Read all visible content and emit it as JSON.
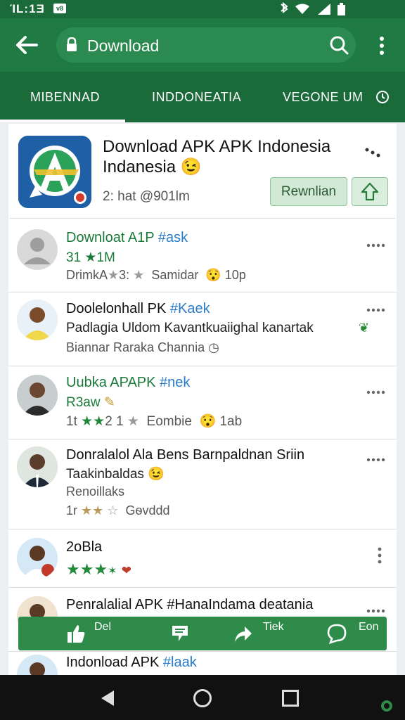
{
  "status_bar": {
    "time": "ΊL:1Ǝ",
    "notification": "v8"
  },
  "toolbar": {
    "search_value": "Download"
  },
  "tabs": [
    {
      "label": "MIBENNAD"
    },
    {
      "label": "INDDONEATIA"
    },
    {
      "label": "VEGONE UM"
    }
  ],
  "app": {
    "title": "Download APK APK Indonesia Indanesia",
    "title_emoji": "😉",
    "meta": "2: hat @901lm",
    "install_label": "Rewnlian"
  },
  "reviews": [
    {
      "title": "Downloat A1P",
      "tag": "#ask",
      "line1": "31 ★1M",
      "meta_prefix": "DrimkA",
      "meta_mid": "3:",
      "meta_name": "Samidar",
      "meta_time": "10p"
    },
    {
      "title": "Doolelonhall PK",
      "tag": "#Kaek",
      "line1": "Padlagia Uldom Kavantkuaiighal  kanartak",
      "line2": "Biannar Raraka Channia"
    },
    {
      "title": "Uubka APAPK",
      "tag": "#nek",
      "line1": "R3aw",
      "meta_prefix": "1t",
      "meta_mid": "2 1",
      "meta_name": "Eombie",
      "meta_time": "1ab"
    },
    {
      "title": "Donralalol Ala Bens Barnpaldnan Sriin",
      "line1": "Taakinbaldas",
      "line2": "Renoillaks",
      "meta_prefix": "1r",
      "meta_name": "Gѳvddd"
    },
    {
      "title": "2oBla"
    },
    {
      "title": "Penralalial APK #HanaIndama deatania"
    },
    {
      "title": "Indonload APK",
      "tag": "#laak"
    }
  ],
  "actions": [
    {
      "label": "Del"
    },
    {
      "label": "Tiek"
    },
    {
      "label": "Eon"
    }
  ],
  "icons": {
    "back": "arrow-left-icon",
    "lock": "lock-icon",
    "search": "search-icon",
    "menu": "more-vert-icon",
    "wifi": "wifi-icon",
    "signal": "signal-icon",
    "battery": "battery-icon",
    "bluetooth": "bluetooth-icon",
    "like": "thumbs-up-icon",
    "save": "flag-icon",
    "share": "share-icon",
    "comment": "chat-bubble-icon"
  },
  "colors": {
    "toolbar": "#1f7a43",
    "tabs": "#1b6b3a",
    "accent": "#22883a",
    "action_bar": "#2e8b4a"
  }
}
